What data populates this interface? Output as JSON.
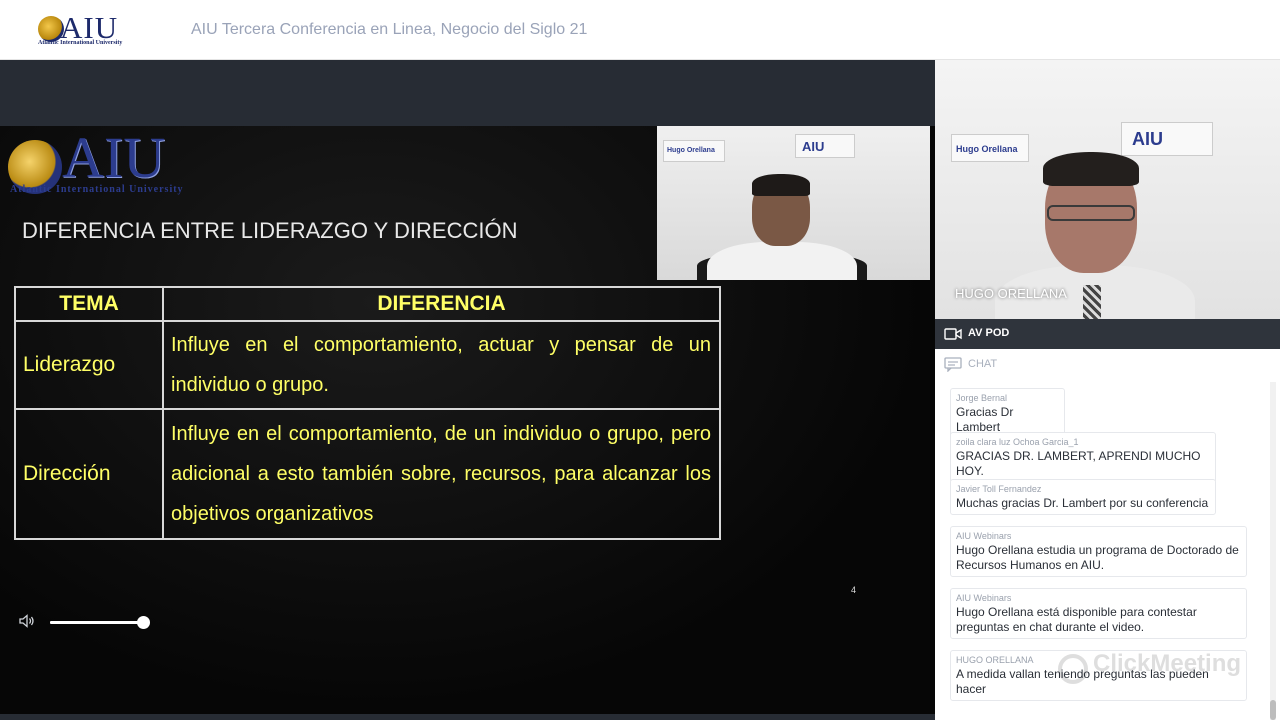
{
  "header": {
    "logo_text": "AIU",
    "logo_subtitle": "Atlantic International University",
    "conference_title": "AIU Tercera Conferencia en Linea, Negocio del Siglo 21"
  },
  "slide": {
    "logo_text": "AIU",
    "logo_subtitle": "Atlantic International University",
    "title": "DIFERENCIA ENTRE LIDERAZGO Y DIRECCIÓN",
    "table": {
      "headers": [
        "TEMA",
        "DIFERENCIA"
      ],
      "rows": [
        {
          "topic": "Liderazgo",
          "description": "Influye en el comportamiento, actuar y pensar de un individuo o grupo."
        },
        {
          "topic": "Dirección",
          "description": "Influye en el comportamiento, de un individuo o grupo, pero adicional a esto también sobre, recursos, para alcanzar los objetivos organizativos"
        }
      ]
    },
    "page_number": "4"
  },
  "pip": {
    "sign_left": "Hugo Orellana",
    "sign_right": "AIU"
  },
  "volume": {
    "icon": "speaker-icon",
    "level": 1.0
  },
  "camera": {
    "presenter_name": "HUGO ORELLANA",
    "sign_left": "Hugo Orellana",
    "sign_right": "AIU"
  },
  "av_pod": {
    "label": "AV POD",
    "icon": "video-camera-icon"
  },
  "chat": {
    "label": "CHAT",
    "icon": "chat-icon",
    "messages": [
      {
        "author": "Jorge Bernal",
        "text": "Gracias Dr Lambert"
      },
      {
        "author": "zoila clara luz Ochoa Garcia_1",
        "text": "GRACIAS DR. LAMBERT, APRENDI MUCHO HOY."
      },
      {
        "author": "Javier Toll Fernandez",
        "text": "Muchas gracias Dr. Lambert por su conferencia"
      },
      {
        "author": "AIU Webinars",
        "text": "Hugo Orellana estudia un programa de Doctorado de Recursos Humanos en AIU."
      },
      {
        "author": "AIU Webinars",
        "text": "Hugo Orellana está disponible para contestar preguntas en chat durante el video."
      },
      {
        "author": "HUGO ORELLANA",
        "text": "A medida vallan teniendo preguntas las pueden hacer"
      }
    ]
  },
  "watermark": {
    "text": "ClickMeeting"
  },
  "colors": {
    "header_bg": "#ffffff",
    "stage_bg": "#272c34",
    "slide_text": "#ffff66",
    "avpod_bg": "#2f343c"
  }
}
